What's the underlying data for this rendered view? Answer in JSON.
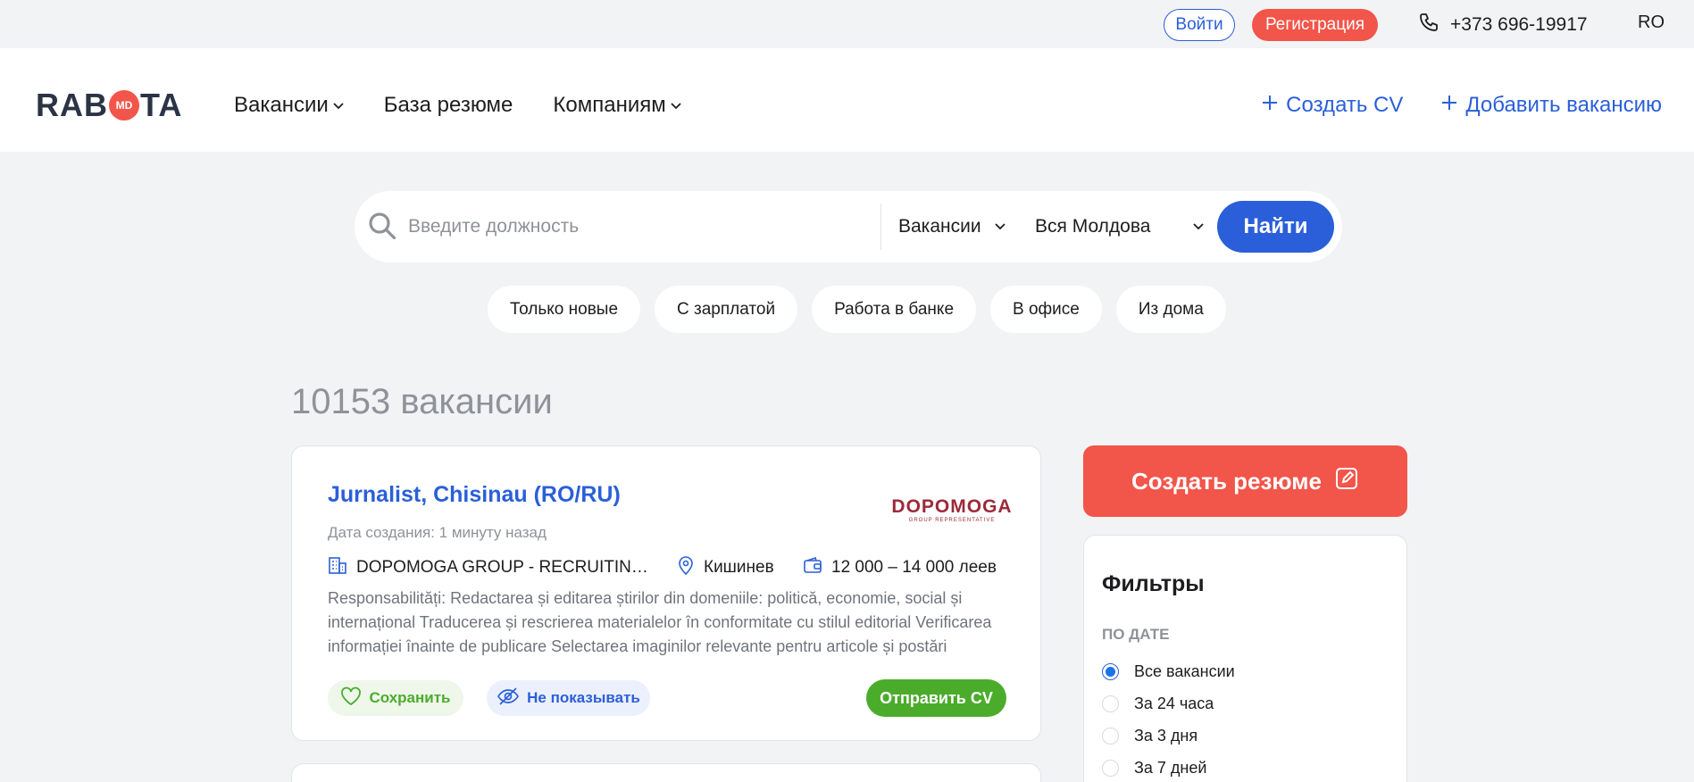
{
  "topbar": {
    "login_label": "Войти",
    "register_label": "Регистрация",
    "phone": "+373 696-19917",
    "language": "RO"
  },
  "header": {
    "logo_left": "RAB",
    "logo_badge": "MD",
    "logo_right": "TA",
    "nav": [
      "Вакансии",
      "База резюме",
      "Компаниям"
    ],
    "create_cv": "Создать CV",
    "add_vacancy": "Добавить вакансию"
  },
  "search": {
    "placeholder": "Введите должность",
    "type_value": "Вакансии",
    "region_value": "Вся Молдова",
    "button": "Найти"
  },
  "chips": [
    "Только новые",
    "С зарплатой",
    "Работа в банке",
    "В офисе",
    "Из дома"
  ],
  "results_count": "10153 вакансии",
  "job": {
    "title": "Jurnalist, Chisinau (RO/RU)",
    "company_logo_text": "DOPOMOGA",
    "company_logo_sub": "GROUP REPRESENTATIVE",
    "created": "Дата создания: 1 минуту назад",
    "company": "DOPOMOGA GROUP - RECRUITING COMPANY",
    "location": "Кишинев",
    "salary": "12 000 – 14 000 леев",
    "description": "Responsabilități: Redactarea și editarea știrilor din domeniile: politică, economie, social și internațional Traducerea și rescrierea materialelor în conformitate cu stilul editorial Verificarea informației înainte de publicare Selectarea imaginilor relevante pentru articole și postări",
    "save_label": "Сохранить",
    "hide_label": "Не показывать",
    "send_label": "Отправить CV"
  },
  "sidebar": {
    "create_resume": "Создать резюме",
    "filters_title": "Фильтры",
    "group_title": "ПО ДАТЕ",
    "options": [
      "Все вакансии",
      "За 24 часа",
      "За 3 дня",
      "За 7 дней"
    ],
    "selected_index": 0
  },
  "colors": {
    "brand_blue": "#2b5fd9",
    "brand_red": "#f2554a",
    "brand_green": "#4bac2c",
    "page_bg": "#f2f3f5"
  }
}
